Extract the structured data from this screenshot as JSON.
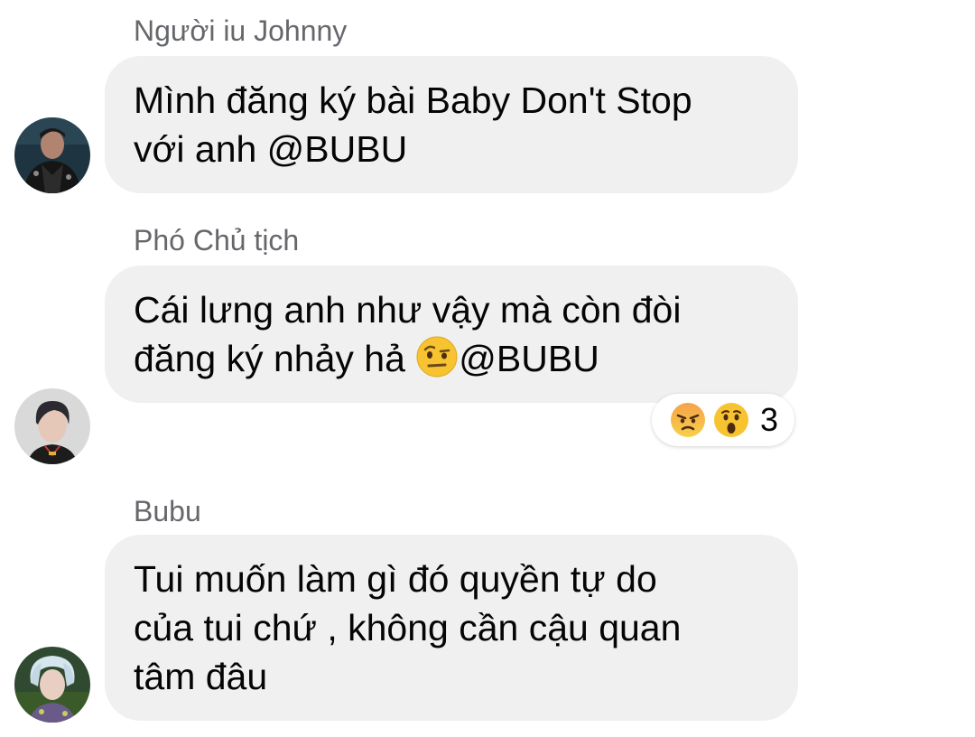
{
  "messages": [
    {
      "sender": "Người iu Johnny",
      "text": "Mình đăng ký bài Baby Don't Stop\nvới anh @BUBU"
    },
    {
      "sender": "Phó Chủ tịch",
      "text_before": "Cái lưng anh như vậy mà còn đòi\nđăng ký nhảy hả ",
      "text_after": "@BUBU",
      "inline_emoji": "raised-eyebrow-emoji",
      "reactions": {
        "icons": [
          "angry-emoji",
          "wow-emoji"
        ],
        "count": "3"
      }
    },
    {
      "sender": "Bubu",
      "text": "Tui muốn làm gì đó quyền tự do\ncủa tui chứ , không cần cậu quan\ntâm đâu"
    }
  ],
  "colors": {
    "bubble": "#f0f0f0",
    "sender": "#65676b",
    "text": "#050505"
  }
}
